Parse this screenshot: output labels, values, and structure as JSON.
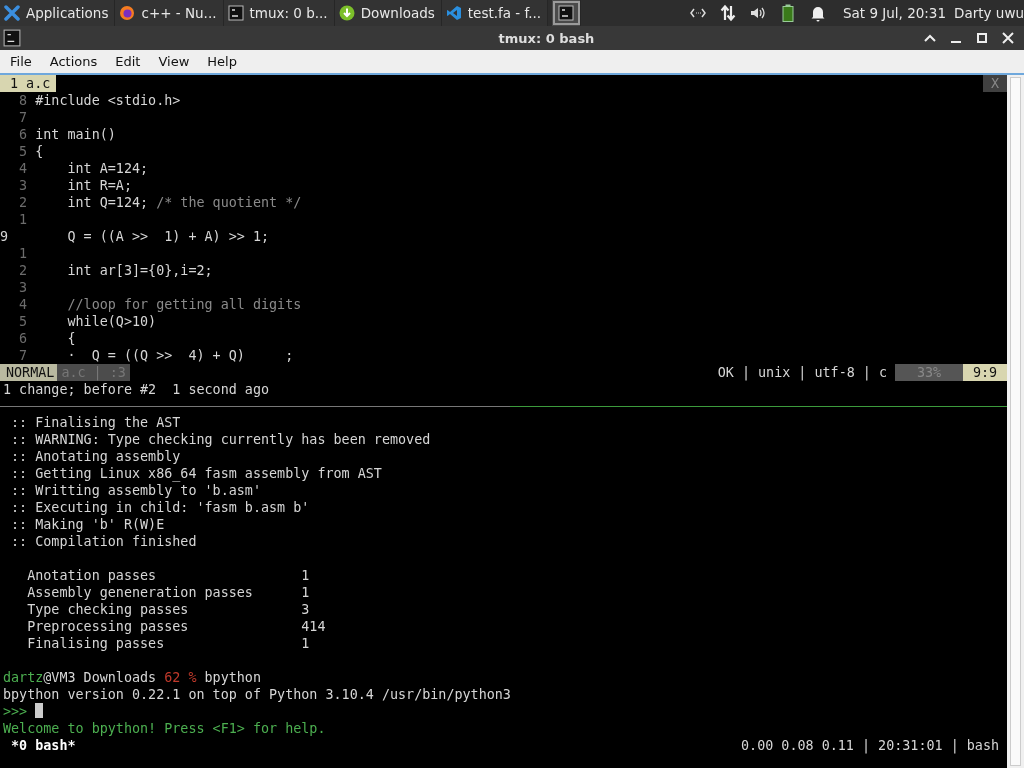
{
  "panel": {
    "apps": [
      {
        "label": "Applications",
        "selected": false
      },
      {
        "label": "c++ - Nu...",
        "selected": false
      },
      {
        "label": "tmux: 0 b...",
        "selected": false
      },
      {
        "label": "Downloads",
        "selected": false
      },
      {
        "label": "test.fa - f...",
        "selected": false
      },
      {
        "selected": true
      }
    ],
    "clock": "Sat  9 Jul, 20:31",
    "user": "Darty uwu"
  },
  "window": {
    "title": "tmux: 0 bash"
  },
  "menu": [
    "File",
    "Actions",
    "Edit",
    "View",
    "Help"
  ],
  "vim": {
    "tab": "1 a.c",
    "close": "X",
    "lines": [
      {
        "number": "8",
        "code": "#include <stdio.h>",
        "current": false
      },
      {
        "number": "7",
        "current": false
      },
      {
        "number": "6",
        "code": "int main()",
        "current": false
      },
      {
        "number": "5",
        "code": "{",
        "current": false
      },
      {
        "number": "4",
        "code": "    int A=124;",
        "current": false
      },
      {
        "number": "3",
        "code": "    int R=A;",
        "current": false
      },
      {
        "number": "2",
        "code": "    int Q=124; ",
        "comment": "/* the quotient */",
        "current": false
      },
      {
        "number": "1",
        "current": false
      },
      {
        "number": "9",
        "code": "    Q = ((A >>  1) + A) >> 1;",
        "current": true
      },
      {
        "number": "1",
        "current": false
      },
      {
        "number": "2",
        "code": "    int ar[3]={0},i=2;",
        "current": false
      },
      {
        "number": "3",
        "current": false
      },
      {
        "number": "4",
        "comment": "    //loop for getting all digits",
        "current": false
      },
      {
        "number": "5",
        "code": "    while(Q>10)",
        "current": false
      },
      {
        "number": "6",
        "code": "    {",
        "current": false
      },
      {
        "number": "7",
        "code": "    ·  Q = ((Q >>  4) + Q)     ;",
        "current": false
      }
    ],
    "mode": "NORMAL",
    "file": "a.c | :3",
    "info": "OK | unix | utf-8 | c",
    "percent": "33%",
    "position": "9:9",
    "message": "1 change; before #2  1 second ago"
  },
  "shell": {
    "output": [
      " :: Finalising the AST",
      " :: WARNING: Type checking currently has been removed",
      " :: Anotating assembly",
      " :: Getting Linux x86_64 fasm assembly from AST",
      " :: Writting assembly to 'b.asm'",
      " :: Executing in child: 'fasm b.asm b'",
      " :: Making 'b' R(W)E",
      " :: Compilation finished"
    ],
    "stats": [
      {
        "label": "Anotation passes",
        "value": "1"
      },
      {
        "label": "Assembly geneneration passes",
        "value": "1"
      },
      {
        "label": "Type checking passes",
        "value": "3"
      },
      {
        "label": "Preprocessing passes",
        "value": "414"
      },
      {
        "label": "Finalising passes",
        "value": "1"
      }
    ],
    "prompt": {
      "user": "dartz",
      "host": "@VM3 Downloads ",
      "status": "62 %",
      "command": " bpython"
    },
    "version": "bpython version 0.22.1 on top of Python 3.10.4 /usr/bin/python3",
    "repl_prompt": ">>>",
    "welcome": "Welcome to bpython! Press <F1> for help."
  },
  "tmux": {
    "window": " *0 bash*",
    "right": "0.00 0.08 0.11 | 20:31:01 | bash"
  }
}
